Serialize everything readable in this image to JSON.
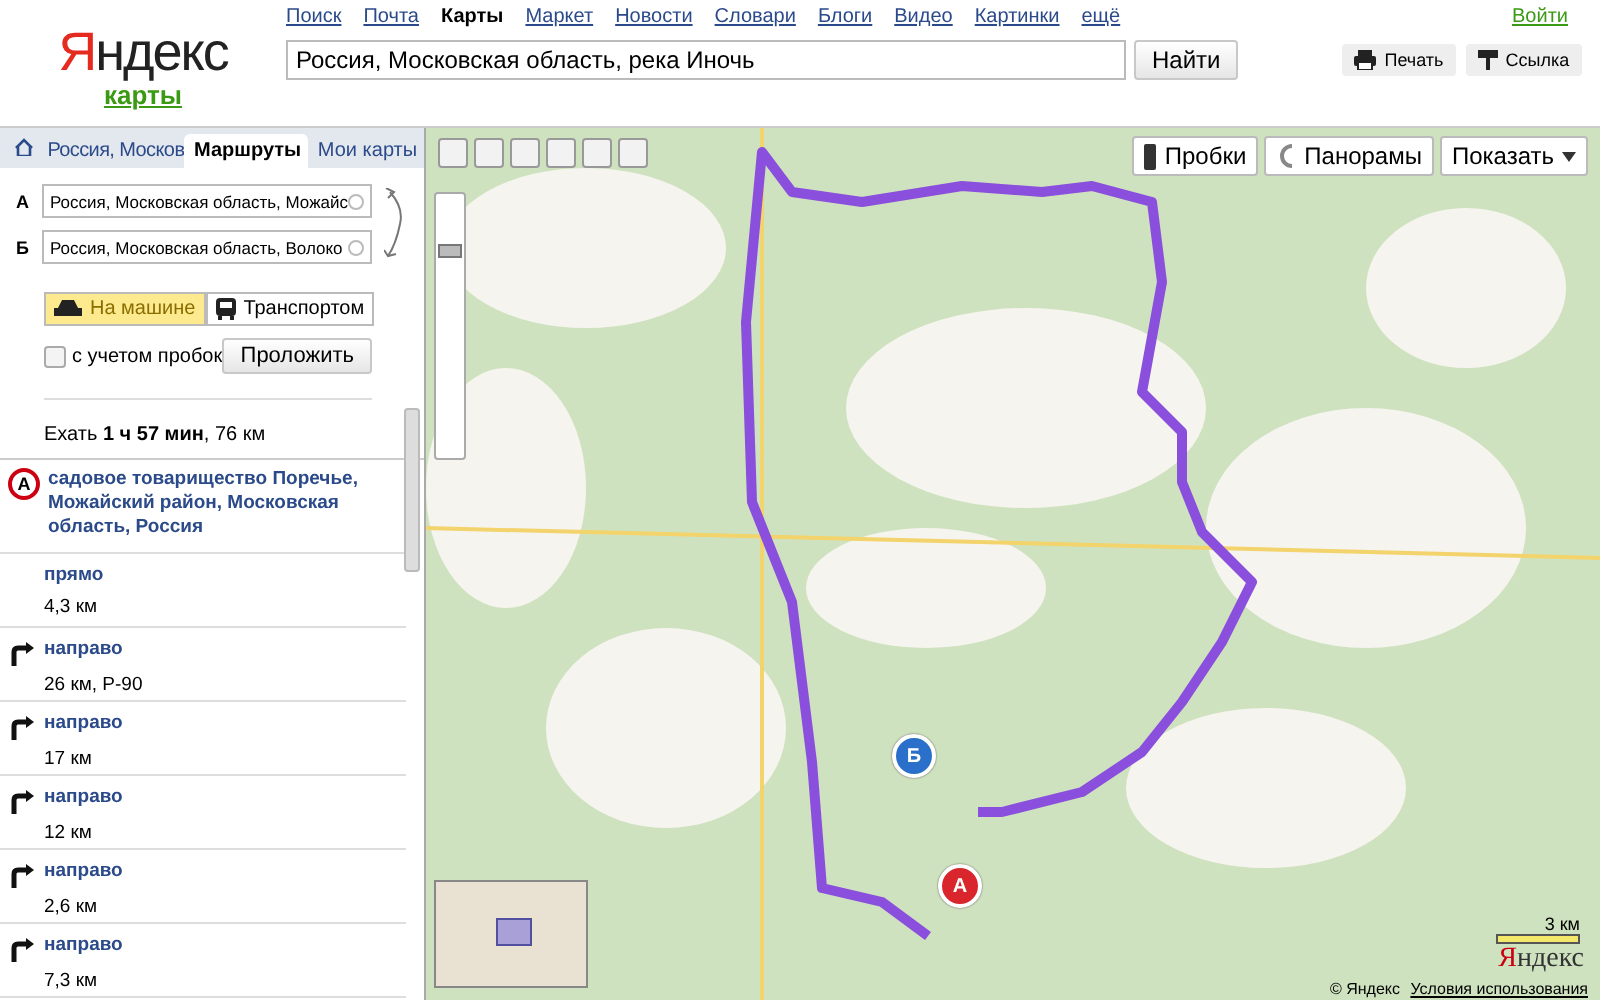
{
  "header": {
    "nav_links": [
      {
        "label": "Поиск",
        "selected": false
      },
      {
        "label": "Почта",
        "selected": false
      },
      {
        "label": "Карты",
        "selected": true
      },
      {
        "label": "Маркет",
        "selected": false
      },
      {
        "label": "Новости",
        "selected": false
      },
      {
        "label": "Словари",
        "selected": false
      },
      {
        "label": "Блоги",
        "selected": false
      },
      {
        "label": "Видео",
        "selected": false
      },
      {
        "label": "Картинки",
        "selected": false
      },
      {
        "label": "ещё",
        "selected": false
      }
    ],
    "login": "Войти",
    "logo": "Яндекс",
    "service": "карты",
    "search": {
      "value": "Россия, Московская область, река Иночь",
      "button": "Найти"
    },
    "actions": [
      {
        "kind": "print",
        "label": "Печать"
      },
      {
        "kind": "link",
        "label": "Ссылка"
      }
    ]
  },
  "sidebar": {
    "tabs": [
      {
        "kind": "home",
        "selected": false
      },
      {
        "kind": "text",
        "label": "Россия, Москов",
        "selected": false
      },
      {
        "kind": "text",
        "label": "Маршруты",
        "selected": true
      },
      {
        "kind": "text",
        "label": "Мои карты",
        "selected": false
      }
    ],
    "route_form": {
      "points": [
        {
          "letter": "А",
          "value": "Россия, Московская область, Можайс"
        },
        {
          "letter": "Б",
          "value": "Россия, Московская область, Волоко"
        }
      ],
      "modes": [
        {
          "kind": "car",
          "label": "На машине",
          "selected": true
        },
        {
          "kind": "bus",
          "label": "Транспортом",
          "selected": false
        }
      ],
      "traffic": {
        "label": "с учетом пробок",
        "checked": false
      },
      "build_button": "Проложить",
      "summary": "Ехать **1 ч 57 мин**, 76 км"
    },
    "start": {
      "letter": "А",
      "address": "садовое товарищество Поречье, Можайский район, Московская область, Россия"
    },
    "steps": [
      {
        "kind": "straight",
        "action": "прямо",
        "distance": "4,3 км"
      },
      {
        "kind": "right",
        "action": "направо",
        "distance": "26 км, Р-90"
      },
      {
        "kind": "right",
        "action": "направо",
        "distance": "17 км"
      },
      {
        "kind": "right",
        "action": "направо",
        "distance": "12 км"
      },
      {
        "kind": "right",
        "action": "направо",
        "distance": "2,6 км"
      },
      {
        "kind": "right",
        "action": "направо",
        "distance": "7,3 км"
      }
    ]
  },
  "map": {
    "zoom": {
      "level": 0.8
    },
    "layer_buttons": [
      {
        "kind": "traffic",
        "label": "Пробки"
      },
      {
        "kind": "panorama",
        "label": "Панорамы"
      }
    ],
    "show_menu": "Показать",
    "markers": [
      {
        "letter": "А",
        "color": "#d8262c"
      },
      {
        "letter": "Б",
        "color": "#2a6fc9"
      }
    ],
    "scale": "3 км",
    "logo": "Яндекс",
    "copyright": "© Яндекс",
    "terms": "Условия использования"
  }
}
